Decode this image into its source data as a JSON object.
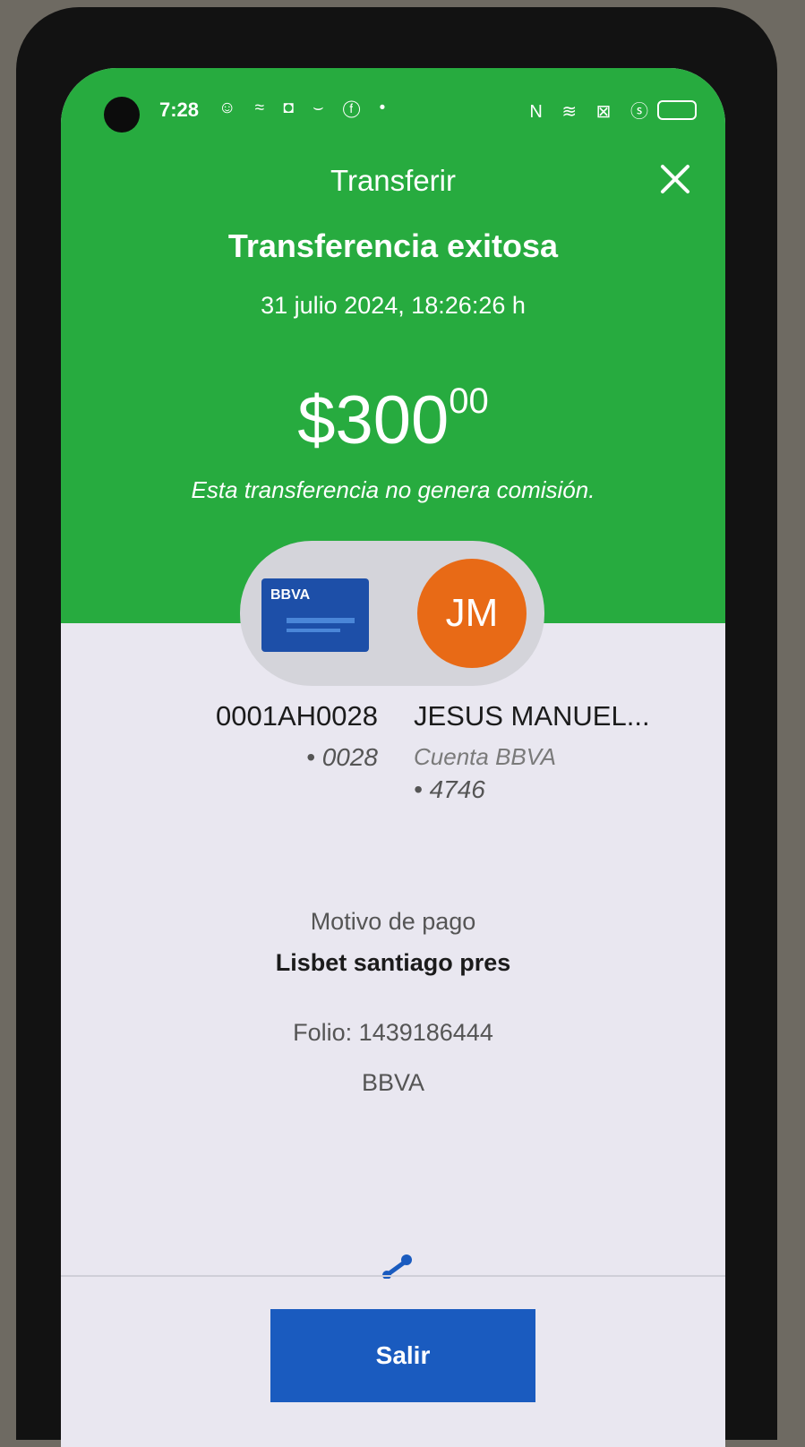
{
  "status_bar": {
    "time": "7:28",
    "left_icons": "☺ ≈ ◘ ⌣ ⓕ •",
    "right_icons": "N ≋ ⊠ ⓢ"
  },
  "header": {
    "title": "Transferir"
  },
  "result": {
    "title": "Transferencia exitosa",
    "datetime": "31 julio 2024, 18:26:26 h",
    "amount_int": "$300",
    "amount_cents": "00",
    "fee_note": "Esta transferencia no genera comisión."
  },
  "origin": {
    "card_logo": "BBVA",
    "account": "0001AH0028",
    "suffix": "• 0028"
  },
  "destination": {
    "initials": "JM",
    "name": "JESUS MANUEL...",
    "bank": "Cuenta BBVA",
    "suffix": "• 4746"
  },
  "details": {
    "motivo_label": "Motivo de pago",
    "motivo_value": "Lisbet santiago pres",
    "folio": "Folio: 1439186444",
    "bank": "BBVA"
  },
  "actions": {
    "exit_label": "Salir"
  },
  "colors": {
    "header_green": "#27ab3f",
    "button_blue": "#1a5bbf",
    "avatar_orange": "#e86a16",
    "card_blue": "#1d4fa8"
  }
}
